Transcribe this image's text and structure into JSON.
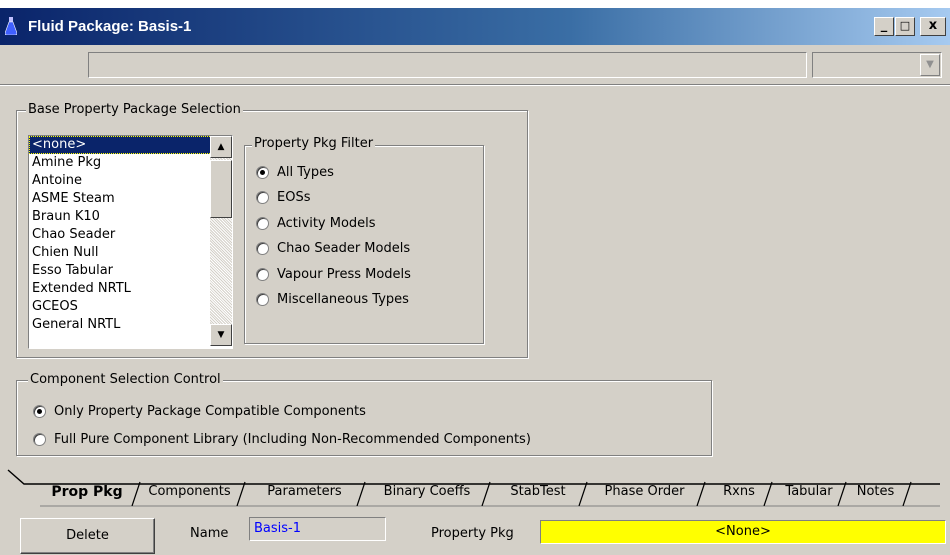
{
  "window": {
    "title": "Fluid Package: Basis-1",
    "minimize": "_",
    "maximize": "□",
    "close": "x",
    "icon": "flask-icon"
  },
  "base_group": {
    "legend": "Base Property Package Selection",
    "packages": [
      "<none>",
      "Amine Pkg",
      "Antoine",
      "ASME Steam",
      "Braun K10",
      "Chao Seader",
      "Chien Null",
      "Esso Tabular",
      "Extended NRTL",
      "GCEOS",
      "General NRTL"
    ],
    "selected_index": 0
  },
  "filter_group": {
    "legend": "Property Pkg Filter",
    "options": [
      "All Types",
      "EOSs",
      "Activity Models",
      "Chao Seader Models",
      "Vapour Press Models",
      "Miscellaneous Types"
    ],
    "selected_index": 0
  },
  "component_group": {
    "legend": "Component Selection Control",
    "options": [
      "Only Property Package Compatible Components",
      "Full Pure Component Library (Including Non-Recommended Components)"
    ],
    "selected_index": 0
  },
  "tabs": [
    "Prop Pkg",
    "Components",
    "Parameters",
    "Binary Coeffs",
    "StabTest",
    "Phase Order",
    "Rxns",
    "Tabular",
    "Notes"
  ],
  "active_tab": 0,
  "bottom": {
    "delete_label": "Delete",
    "name_label": "Name",
    "name_value": "Basis-1",
    "pkg_label": "Property Pkg",
    "pkg_value": "<None>"
  },
  "colors": {
    "title_bar": "#0a246a",
    "face": "#d4d0c8",
    "selection": "#0a246a",
    "pkg_field": "#ffff00",
    "name_text": "#0000ff"
  }
}
